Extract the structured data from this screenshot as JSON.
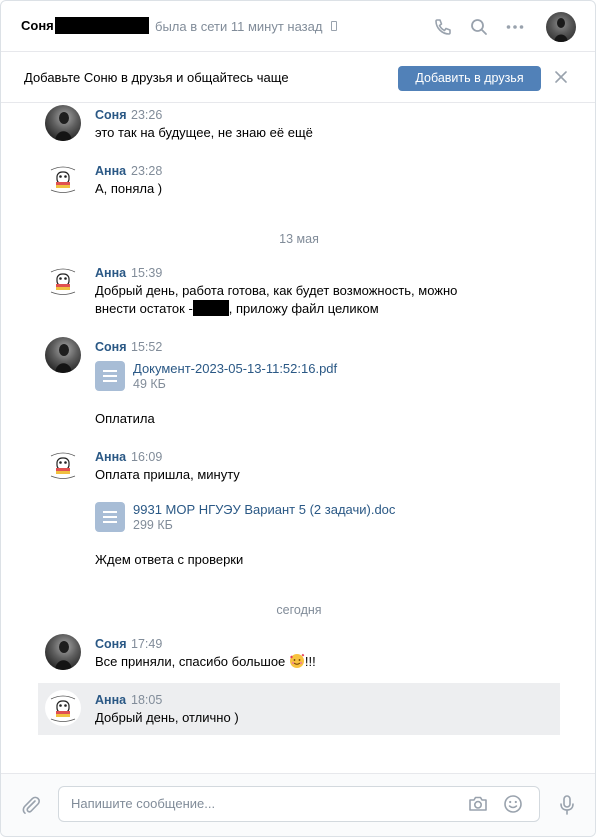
{
  "header": {
    "name": "Соня",
    "status": "была в сети 11 минут назад"
  },
  "banner": {
    "text": "Добавьте Соню в друзья и общайтесь чаще",
    "button": "Добавить в друзья"
  },
  "messages": [
    {
      "author": "Соня",
      "time": "23:26",
      "text": "это так на будущее, не знаю её ещё"
    },
    {
      "author": "Анна",
      "time": "23:28",
      "text": "А, поняла )"
    },
    {
      "author": "Анна",
      "time": "15:39",
      "text_line1": "Добрый день, работа готова, как будет возможность, можно",
      "text_line2_before": "внести остаток -",
      "text_line2_after": ", приложу файл целиком"
    },
    {
      "author": "Соня",
      "time": "15:52",
      "doc_name": "Документ-2023-05-13-11:52:16.pdf",
      "doc_size": "49 КБ",
      "text": "Оплатила"
    },
    {
      "author": "Анна",
      "time": "16:09",
      "text": "Оплата пришла, минуту",
      "doc_name": "9931 МОР НГУЭУ Вариант 5 (2 задачи).doc",
      "doc_size": "299 КБ",
      "text2": "Ждем ответа с проверки"
    },
    {
      "author": "Соня",
      "time": "17:49",
      "text": "Все приняли, спасибо большое",
      "text_after": "!!!"
    },
    {
      "author": "Анна",
      "time": "18:05",
      "text": "Добрый день, отлично )"
    }
  ],
  "dates": [
    "13 мая",
    "сегодня"
  ],
  "composer": {
    "placeholder": "Напишите сообщение..."
  },
  "colors": {
    "accent": "#5181b8",
    "author": "#2a5885",
    "muted": "#818c99"
  }
}
